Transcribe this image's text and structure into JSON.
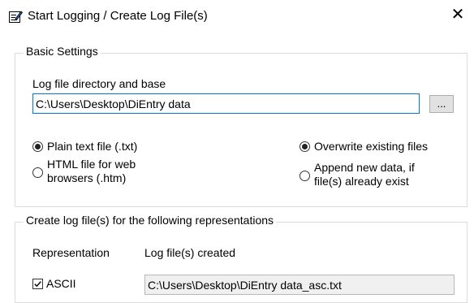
{
  "window": {
    "title": "Start Logging / Create Log File(s)",
    "close_glyph": "✕",
    "icon": "notepad-edit-icon"
  },
  "basic_settings": {
    "group_label": "Basic Settings",
    "directory_label": "Log file directory and base",
    "directory_value": "C:\\Users\\Desktop\\DiEntry data",
    "browse_label": "...",
    "format_options": [
      {
        "label": "Plain text file (.txt)",
        "selected": true
      },
      {
        "label_line1": "HTML file for web",
        "label_line2": "browsers (.htm)",
        "selected": false
      }
    ],
    "write_options": [
      {
        "label": "Overwrite existing files",
        "selected": true
      },
      {
        "label_line1": "Append new data, if",
        "label_line2": "file(s) already exist",
        "selected": false
      }
    ]
  },
  "representations": {
    "group_label": "Create log file(s) for the following representations",
    "col_representation": "Representation",
    "col_files": "Log file(s) created",
    "rows": [
      {
        "name": "ASCII",
        "checked": true,
        "file": "C:\\Users\\Desktop\\DiEntry data_asc.txt"
      }
    ]
  },
  "colors": {
    "focus_border": "#0078d7",
    "group_border": "#dcdcdc"
  }
}
